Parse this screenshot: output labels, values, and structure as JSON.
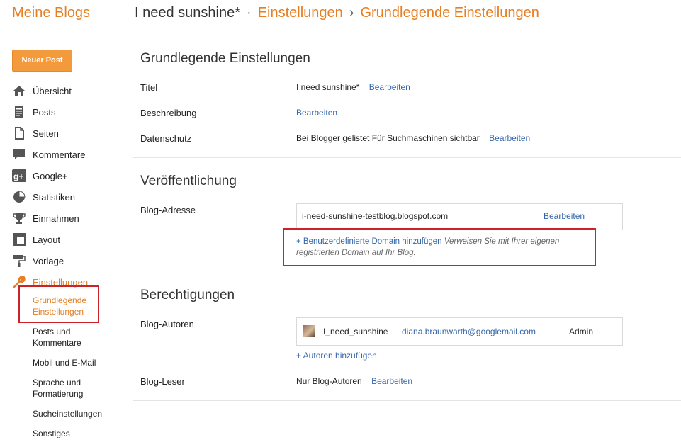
{
  "header": {
    "brand": "Meine Blogs",
    "blog_title": "I need sunshine*",
    "separator_dot": "·",
    "crumb_1": "Einstellungen",
    "crumb_arrow": "›",
    "crumb_2": "Grundlegende Einstellungen"
  },
  "sidebar": {
    "new_post": "Neuer Post",
    "items": [
      {
        "label": "Übersicht",
        "icon": "home-icon"
      },
      {
        "label": "Posts",
        "icon": "posts-icon"
      },
      {
        "label": "Seiten",
        "icon": "pages-icon"
      },
      {
        "label": "Kommentare",
        "icon": "comments-icon"
      },
      {
        "label": "Google+",
        "icon": "google-plus-icon"
      },
      {
        "label": "Statistiken",
        "icon": "pie-chart-icon"
      },
      {
        "label": "Einnahmen",
        "icon": "trophy-icon"
      },
      {
        "label": "Layout",
        "icon": "layout-icon"
      },
      {
        "label": "Vorlage",
        "icon": "paint-roller-icon"
      },
      {
        "label": "Einstellungen",
        "icon": "wrench-icon"
      }
    ],
    "subitems": [
      {
        "label": "Grundlegende Einstellungen"
      },
      {
        "label": "Posts und Kommentare"
      },
      {
        "label": "Mobil und E-Mail"
      },
      {
        "label": "Sprache und Formatierung"
      },
      {
        "label": "Sucheinstellungen"
      },
      {
        "label": "Sonstiges"
      }
    ]
  },
  "basic": {
    "title": "Grundlegende Einstellungen",
    "titel_label": "Titel",
    "titel_value": "I need sunshine*",
    "beschreibung_label": "Beschreibung",
    "datenschutz_label": "Datenschutz",
    "datenschutz_value": "Bei Blogger gelistet Für Suchmaschinen sichtbar",
    "edit": "Bearbeiten"
  },
  "publishing": {
    "title": "Veröffentlichung",
    "address_label": "Blog-Adresse",
    "address_value": "i-need-sunshine-testblog.blogspot.com",
    "custom_domain_link": "+ Benutzerdefinierte Domain hinzufügen",
    "custom_domain_hint": "Verweisen Sie mit Ihrer eigenen registrierten Domain auf Ihr Blog."
  },
  "permissions": {
    "title": "Berechtigungen",
    "authors_label": "Blog-Autoren",
    "author_name": "I_need_sunshine",
    "author_email": "diana.braunwarth@googlemail.com",
    "author_role": "Admin",
    "add_authors": "+ Autoren hinzufügen",
    "readers_label": "Blog-Leser",
    "readers_value": "Nur Blog-Autoren"
  },
  "colors": {
    "accent": "#e67e22",
    "link": "#3366aa",
    "highlight": "#cc2229"
  }
}
